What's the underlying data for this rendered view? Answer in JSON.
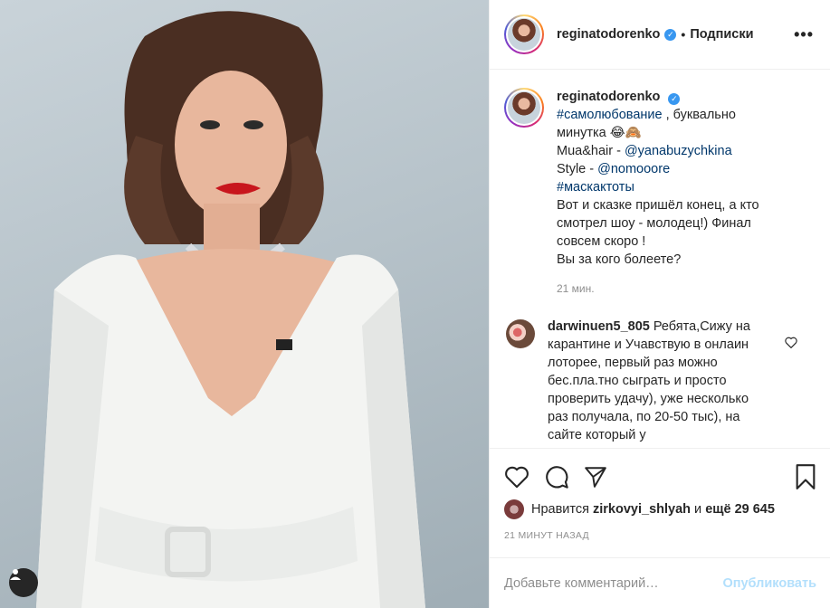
{
  "header": {
    "username": "reginatodorenko",
    "separator": "•",
    "follow_label": "Подписки",
    "more_label": "•••"
  },
  "caption": {
    "username": "reginatodorenko",
    "lines": [
      {
        "text": "#самолюбование",
        "rest": " , буквально"
      },
      {
        "text": "минутка 😂🙈"
      },
      {
        "prefix": "Mua&hair - ",
        "link": "@yanabuzychkina"
      },
      {
        "prefix": "Style - ",
        "link": "@nomooore"
      },
      {
        "link": "#маскактоты"
      },
      {
        "text": "Вот и сказке пришёл конец, а кто"
      },
      {
        "text": "смотрел шоу - молодец!) Финал"
      },
      {
        "text": "совсем скоро !"
      },
      {
        "text": "Вы за кого болеете?"
      }
    ],
    "time": "21 мин."
  },
  "comment": {
    "username": "darwinuen5_805",
    "text": "Ребята,Сижу на карантине и Учавствую в онлаин лоторее, первый раз можно бес.пла.тно сыграть и просто проверить удачу), уже несколько раз получала, по 20-50 тыс), на сайте который у"
  },
  "likes": {
    "prefix": "Нравится",
    "user": "zirkovyi_shlyah",
    "conj": "и",
    "rest": "ещё 29 645"
  },
  "posted_ago": "21 МИНУТ НАЗАД",
  "add_comment": {
    "placeholder": "Добавьте комментарий…",
    "publish_label": "Опубликовать"
  },
  "colors": {
    "link": "#00376b",
    "verified": "#3897f0",
    "publish_disabled": "#b2dffc",
    "muted": "#8e8e8e"
  }
}
